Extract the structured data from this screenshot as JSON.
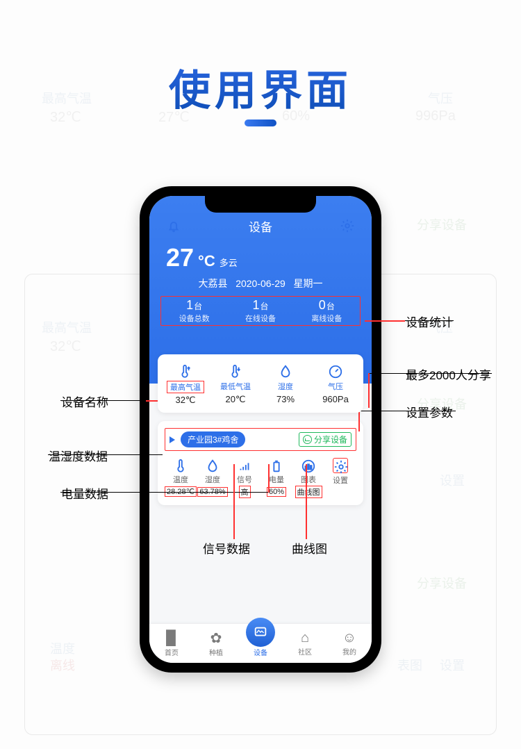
{
  "page_title": "使用界面",
  "header": {
    "title": "设备",
    "temp_value": "27",
    "temp_unit": "°C",
    "weather": "多云",
    "location": "大荔县",
    "date": "2020-06-29",
    "weekday": "星期一"
  },
  "stats": [
    {
      "num": "1",
      "unit": "台",
      "label": "设备总数"
    },
    {
      "num": "1",
      "unit": "台",
      "label": "在线设备"
    },
    {
      "num": "0",
      "unit": "台",
      "label": "离线设备"
    }
  ],
  "weather_card": [
    {
      "label": "最高气温",
      "value": "32℃"
    },
    {
      "label": "最低气温",
      "value": "20℃"
    },
    {
      "label": "湿度",
      "value": "73%"
    },
    {
      "label": "气压",
      "value": "960Pa"
    }
  ],
  "device": {
    "name": "产业园3#鸡舍",
    "share_label": "分享设备",
    "items": [
      {
        "label": "温度",
        "value": "28.28℃"
      },
      {
        "label": "湿度",
        "value": "63.78%"
      },
      {
        "label": "信号",
        "value": "高"
      },
      {
        "label": "电量",
        "value": "60%"
      },
      {
        "label": "图表",
        "value": "曲线图"
      },
      {
        "label": "设置",
        "value": ""
      }
    ]
  },
  "nav": [
    {
      "label": "首页"
    },
    {
      "label": "种植"
    },
    {
      "label": "设备"
    },
    {
      "label": "社区"
    },
    {
      "label": "我的"
    }
  ],
  "annotations": {
    "device_stats": "设备统计",
    "max_share": "最多2000人分享",
    "set_params": "设置参数",
    "device_name": "设备名称",
    "temp_humid_data": "温湿度数据",
    "battery_data": "电量数据",
    "signal_data": "信号数据",
    "curve_chart": "曲线图"
  },
  "ghost": {
    "max_temp_label": "最高气温",
    "max_temp_val": "32℃",
    "min_temp_val": "27℃",
    "humid_val": "60%",
    "pressure_label": "气压",
    "pressure_val": "996Pa",
    "share_device": "分享设备",
    "temp_label": "温度",
    "offline": "离线",
    "chart_label": "表图",
    "setting_label": "设置"
  }
}
